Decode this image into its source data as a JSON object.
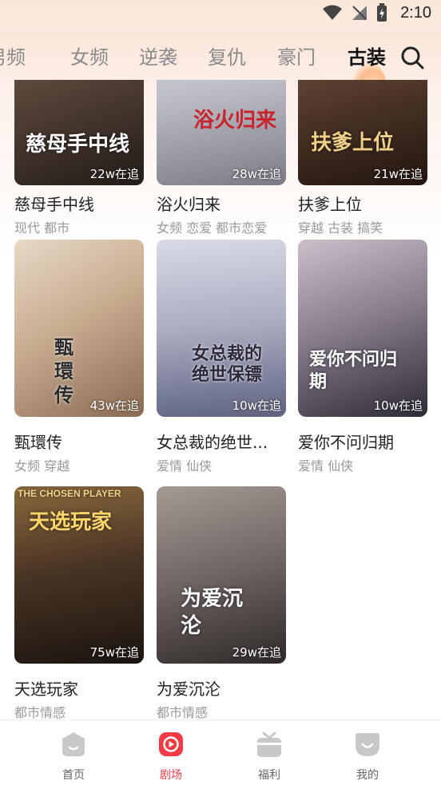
{
  "status_bar": {
    "time": "2:10"
  },
  "tabs": [
    {
      "label": "男频",
      "active": false
    },
    {
      "label": "女频",
      "active": false
    },
    {
      "label": "逆袭",
      "active": false
    },
    {
      "label": "复仇",
      "active": false
    },
    {
      "label": "豪门",
      "active": false
    },
    {
      "label": "古装",
      "active": true
    }
  ],
  "dramas": [
    {
      "title": "慈母手中线",
      "tags": "现代 都市",
      "followers": "22w在追",
      "poster_text": "慈母手中线",
      "palette": [
        "#6b5445",
        "#2c2420"
      ]
    },
    {
      "title": "浴火归来",
      "tags": "女频 恋爱 都市恋爱",
      "followers": "28w在追",
      "poster_text": "浴火归来",
      "palette": [
        "#d8d8dc",
        "#8e8f96"
      ]
    },
    {
      "title": "扶爹上位",
      "tags": "穿越 古装 搞笑",
      "followers": "21w在追",
      "poster_text": "扶爹上位",
      "palette": [
        "#6a4a3a",
        "#2a1c16"
      ]
    },
    {
      "title": "甄環传",
      "tags": "女频 穿越",
      "followers": "43w在追",
      "poster_text": "甄環传",
      "palette": [
        "#d9c8b4",
        "#8c6f58"
      ]
    },
    {
      "title": "女总裁的绝世...",
      "tags": "爱情 仙侠",
      "followers": "10w在追",
      "poster_text": "女总裁的绝世保镖",
      "palette": [
        "#c9cad8",
        "#6f7390"
      ]
    },
    {
      "title": "爱你不问归期",
      "tags": "爱情 仙侠",
      "followers": "10w在追",
      "poster_text": "爱你不问归期",
      "palette": [
        "#a79aa8",
        "#3f3a48"
      ]
    },
    {
      "title": "天选玩家",
      "tags": "都市情感",
      "followers": "75w在追",
      "poster_text": "天选玩家",
      "poster_subtext": "THE CHOSEN PLAYER",
      "palette": [
        "#7a5a3a",
        "#1e1612"
      ]
    },
    {
      "title": "为爱沉沦",
      "tags": "都市情感",
      "followers": "29w在追",
      "poster_text": "为爱沉沦",
      "palette": [
        "#8d8583",
        "#3a3433"
      ]
    }
  ],
  "bottom_nav": [
    {
      "label": "首页",
      "icon": "home-icon",
      "active": false
    },
    {
      "label": "剧场",
      "icon": "theater-icon",
      "active": true
    },
    {
      "label": "福利",
      "icon": "gift-icon",
      "active": false
    },
    {
      "label": "我的",
      "icon": "profile-icon",
      "active": false
    }
  ],
  "colors": {
    "accent": "#f23b45",
    "underline": "#ee3a29",
    "muted": "#999999",
    "tab_inactive": "#8a8a8a"
  }
}
